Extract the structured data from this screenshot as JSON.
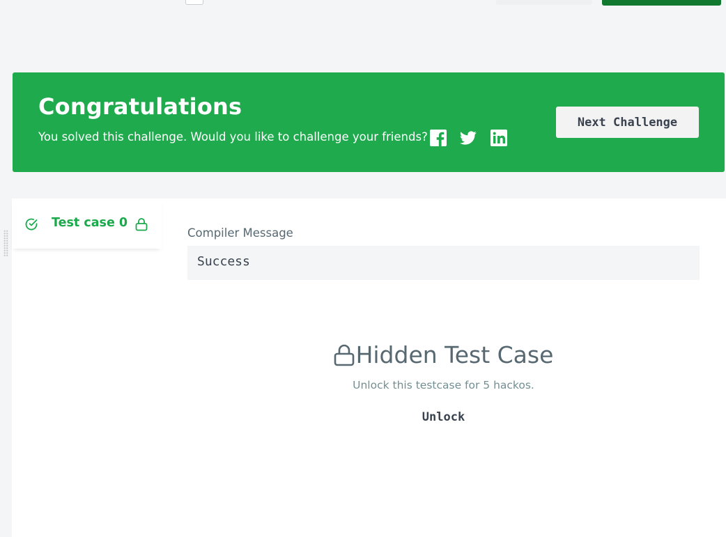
{
  "banner": {
    "title": "Congratulations",
    "message": "You solved this challenge. Would you like to challenge your friends?",
    "next_button": "Next Challenge",
    "social_icons": [
      "facebook-icon",
      "twitter-icon",
      "linkedin-icon"
    ]
  },
  "results": {
    "tab_label": "Test case 0",
    "tab_status": "passed",
    "compiler_label": "Compiler Message",
    "compiler_message": "Success",
    "hidden_title": "Hidden Test Case",
    "hidden_subtitle": "Unlock this testcase for 5 hackos.",
    "unlock_button": "Unlock"
  },
  "colors": {
    "banner_green": "#1eaa4d",
    "success_green": "#1ba94c",
    "dark_green": "#11792f",
    "text_dark": "#39424e",
    "text_muted": "#576871"
  }
}
